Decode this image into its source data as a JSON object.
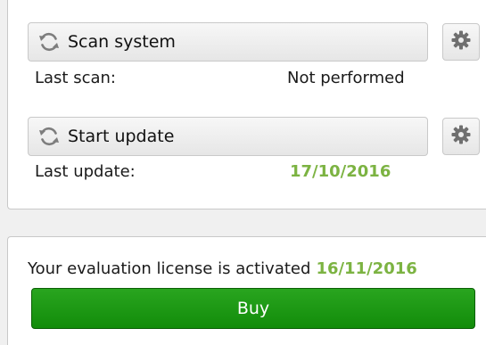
{
  "scan": {
    "button_label": "Scan system",
    "status_label": "Last scan:",
    "status_value": "Not performed",
    "icon": "refresh-icon",
    "settings_icon": "gear-icon"
  },
  "update": {
    "button_label": "Start update",
    "status_label": "Last update:",
    "status_value": "17/10/2016",
    "icon": "refresh-icon",
    "settings_icon": "gear-icon"
  },
  "license": {
    "text": "Your evaluation license is activated",
    "date": "16/11/2016",
    "buy_label": "Buy"
  },
  "colors": {
    "accent_green_text": "#7cb342",
    "buy_button": "#1a9a12"
  }
}
